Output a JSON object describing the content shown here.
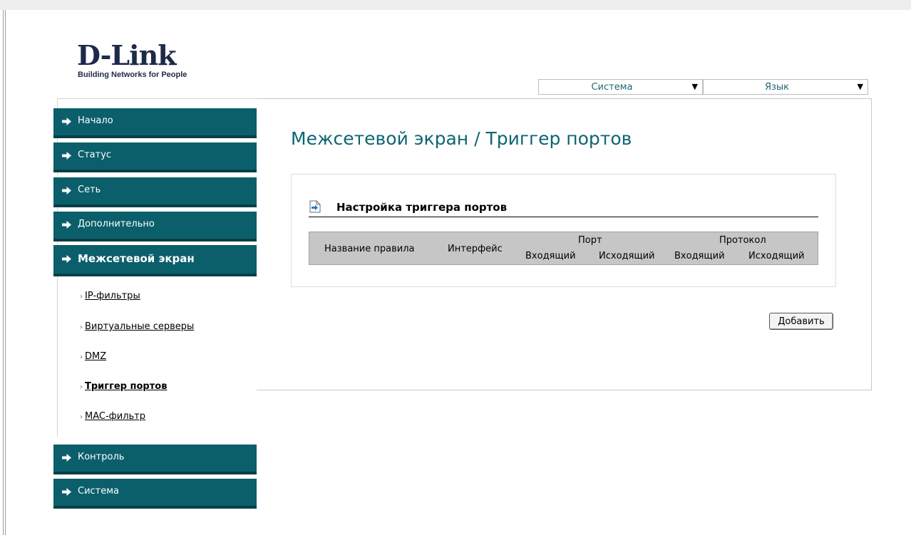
{
  "logo": {
    "brand": "D-Link",
    "tagline": "Building Networks for People"
  },
  "top_menus": {
    "system": "Система",
    "language": "Язык"
  },
  "sidebar": {
    "items": [
      {
        "label": "Начало"
      },
      {
        "label": "Статус"
      },
      {
        "label": "Сеть"
      },
      {
        "label": "Дополнительно"
      },
      {
        "label": "Межсетевой экран",
        "active": true
      },
      {
        "label": "Контроль"
      },
      {
        "label": "Система"
      }
    ],
    "subitems": [
      {
        "label": "IP-фильтры"
      },
      {
        "label": "Виртуальные серверы"
      },
      {
        "label": "DMZ"
      },
      {
        "label": "Триггер портов",
        "current": true
      },
      {
        "label": "MAC-фильтр"
      }
    ]
  },
  "main": {
    "title": "Межсетевой экран /  Триггер портов",
    "section_title": "Настройка триггера портов",
    "table": {
      "col_rule_name": "Название правила",
      "col_interface": "Интерфейс",
      "group_port": "Порт",
      "group_protocol": "Протокол",
      "port_incoming": "Входящий",
      "port_outgoing": "Исходящий",
      "protocol_incoming": "Входящий",
      "protocol_outgoing": "Исходящий"
    },
    "add_button": "Добавить"
  },
  "colors": {
    "nav_bg": "#0b5f6b",
    "title_text": "#0e6572",
    "table_header_bg": "#c6c6c6"
  }
}
